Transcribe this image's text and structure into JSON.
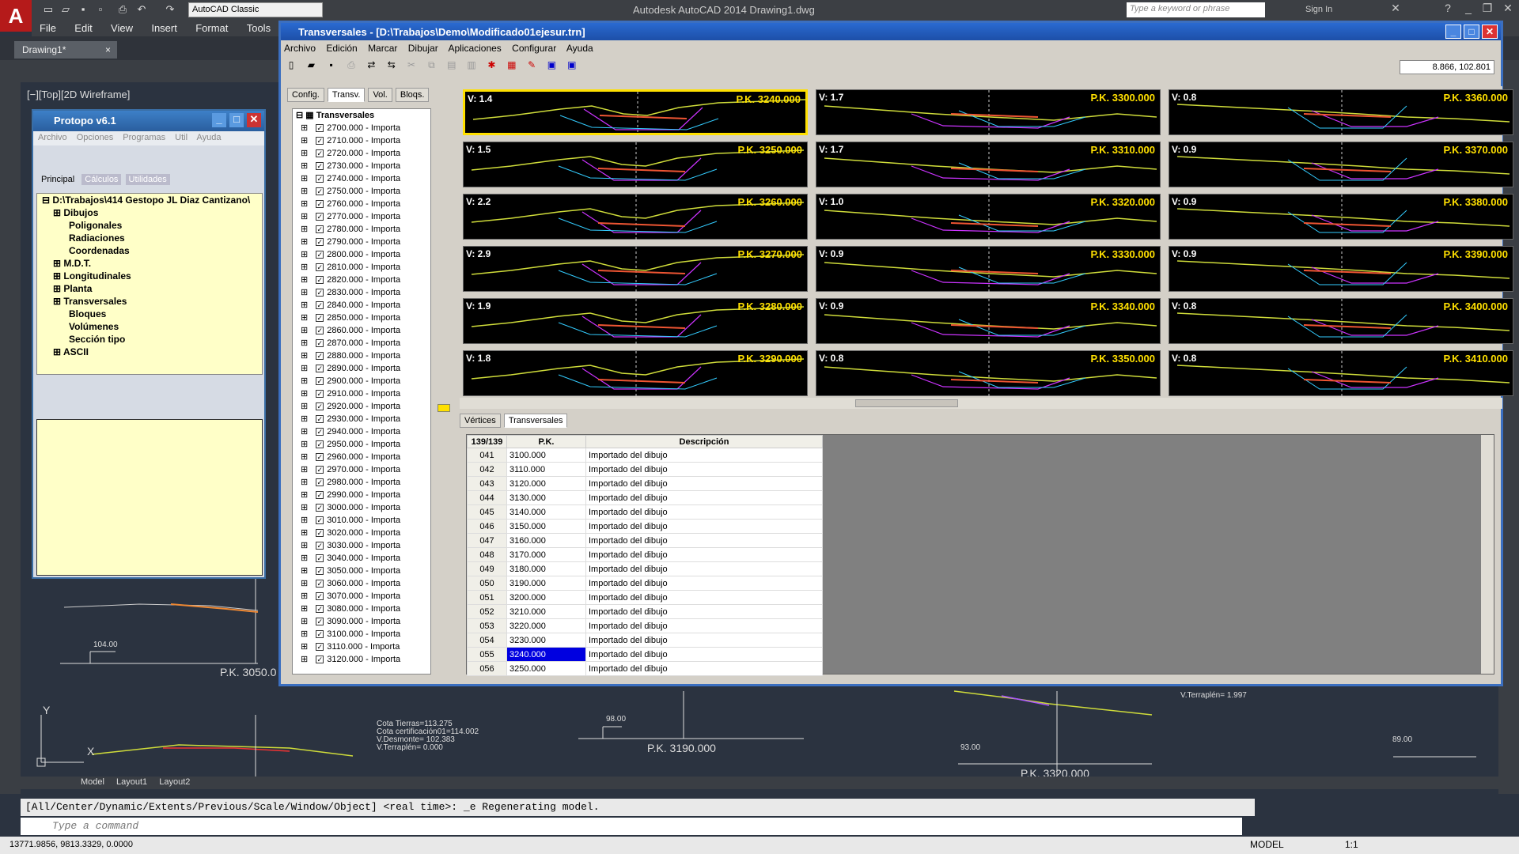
{
  "acad": {
    "logo": "A",
    "workspace": "AutoCAD Classic",
    "title": "Autodesk AutoCAD 2014    Drawing1.dwg",
    "search_placeholder": "Type a keyword or phrase",
    "signin": "Sign In",
    "menu": [
      "File",
      "Edit",
      "View",
      "Insert",
      "Format",
      "Tools"
    ],
    "doc_tab": "Drawing1*",
    "viewport_label": "[−][Top][2D Wireframe]",
    "layout_tabs": [
      "Model",
      "Layout1",
      "Layout2"
    ],
    "command_history": "[All/Center/Dynamic/Extents/Previous/Scale/Window/Object] <real time>: _e Regenerating model.",
    "command_placeholder": "Type a command",
    "coords": "13771.9856, 9813.3329, 0.0000",
    "model_label": "MODEL",
    "scale": "1:1"
  },
  "canvas": {
    "labels_top": [
      "104.00",
      "P.K. 3050.0"
    ],
    "info_block": [
      "Cota Tierras=113.275",
      "Cota certificación01=114.002",
      "V.Desmonte= 102.383",
      "V.Terraplén= 0.000"
    ],
    "label_9800": "98.00",
    "pk_3190": "P.K. 3190.000",
    "label_9300": "93.00",
    "pk_3320": "P.K. 3320.000",
    "label_8900": "89.00",
    "vterraplen": "V.Terraplén= 1.997",
    "axis_y": "Y",
    "axis_x": "X"
  },
  "protopo": {
    "title": "Protopo v6.1",
    "menu": [
      "Archivo",
      "Opciones",
      "Programas",
      "Util",
      "Ayuda"
    ],
    "tabs": [
      "Principal",
      "Cálculos",
      "Utilidades"
    ],
    "tree_root": "D:\\Trabajos\\414 Gestopo JL Diaz Cantizano\\",
    "tree_items": [
      "Dibujos",
      "Poligonales",
      "Radiaciones",
      "Coordenadas",
      "M.D.T.",
      "Longitudinales",
      "Planta",
      "Transversales",
      "Bloques",
      "Volúmenes",
      "Sección tipo",
      "ASCII"
    ]
  },
  "tw": {
    "title": "Transversales - [D:\\Trabajos\\Demo\\Modificado01ejesur.trn]",
    "menu": [
      "Archivo",
      "Edición",
      "Marcar",
      "Dibujar",
      "Aplicaciones",
      "Configurar",
      "Ayuda"
    ],
    "coord_readout": "8.866, 102.801",
    "left_tabs": [
      "Config.",
      "Transv.",
      "Vol.",
      "Bloqs."
    ],
    "tree_root": "Transversales",
    "tree_items": [
      "2700.000 - Importa",
      "2710.000 - Importa",
      "2720.000 - Importa",
      "2730.000 - Importa",
      "2740.000 - Importa",
      "2750.000 - Importa",
      "2760.000 - Importa",
      "2770.000 - Importa",
      "2780.000 - Importa",
      "2790.000 - Importa",
      "2800.000 - Importa",
      "2810.000 - Importa",
      "2820.000 - Importa",
      "2830.000 - Importa",
      "2840.000 - Importa",
      "2850.000 - Importa",
      "2860.000 - Importa",
      "2870.000 - Importa",
      "2880.000 - Importa",
      "2890.000 - Importa",
      "2900.000 - Importa",
      "2910.000 - Importa",
      "2920.000 - Importa",
      "2930.000 - Importa",
      "2940.000 - Importa",
      "2950.000 - Importa",
      "2960.000 - Importa",
      "2970.000 - Importa",
      "2980.000 - Importa",
      "2990.000 - Importa",
      "3000.000 - Importa",
      "3010.000 - Importa",
      "3020.000 - Importa",
      "3030.000 - Importa",
      "3040.000 - Importa",
      "3050.000 - Importa",
      "3060.000 - Importa",
      "3070.000 - Importa",
      "3080.000 - Importa",
      "3090.000 - Importa",
      "3100.000 - Importa",
      "3110.000 - Importa",
      "3120.000 - Importa"
    ],
    "sections": [
      {
        "v": "V: 1.4",
        "pk": "P.K. 3240.000"
      },
      {
        "v": "V: 1.7",
        "pk": "P.K. 3300.000"
      },
      {
        "v": "V: 0.8",
        "pk": "P.K. 3360.000"
      },
      {
        "v": "V: 1.5",
        "pk": "P.K. 3250.000"
      },
      {
        "v": "V: 1.7",
        "pk": "P.K. 3310.000"
      },
      {
        "v": "V: 0.9",
        "pk": "P.K. 3370.000"
      },
      {
        "v": "V: 2.2",
        "pk": "P.K. 3260.000"
      },
      {
        "v": "V: 1.0",
        "pk": "P.K. 3320.000"
      },
      {
        "v": "V: 0.9",
        "pk": "P.K. 3380.000"
      },
      {
        "v": "V: 2.9",
        "pk": "P.K. 3270.000"
      },
      {
        "v": "V: 0.9",
        "pk": "P.K. 3330.000"
      },
      {
        "v": "V: 0.9",
        "pk": "P.K. 3390.000"
      },
      {
        "v": "V: 1.9",
        "pk": "P.K. 3280.000"
      },
      {
        "v": "V: 0.9",
        "pk": "P.K. 3340.000"
      },
      {
        "v": "V: 0.8",
        "pk": "P.K. 3400.000"
      },
      {
        "v": "V: 1.8",
        "pk": "P.K. 3290.000"
      },
      {
        "v": "V: 0.8",
        "pk": "P.K. 3350.000"
      },
      {
        "v": "V: 0.8",
        "pk": "P.K. 3410.000"
      }
    ],
    "bottom_tabs": [
      "Vértices",
      "Transversales"
    ],
    "grid_headers": [
      "139/139",
      "P.K.",
      "Descripción"
    ],
    "grid_rows": [
      [
        "041",
        "3100.000",
        "Importado del dibujo"
      ],
      [
        "042",
        "3110.000",
        "Importado del dibujo"
      ],
      [
        "043",
        "3120.000",
        "Importado del dibujo"
      ],
      [
        "044",
        "3130.000",
        "Importado del dibujo"
      ],
      [
        "045",
        "3140.000",
        "Importado del dibujo"
      ],
      [
        "046",
        "3150.000",
        "Importado del dibujo"
      ],
      [
        "047",
        "3160.000",
        "Importado del dibujo"
      ],
      [
        "048",
        "3170.000",
        "Importado del dibujo"
      ],
      [
        "049",
        "3180.000",
        "Importado del dibujo"
      ],
      [
        "050",
        "3190.000",
        "Importado del dibujo"
      ],
      [
        "051",
        "3200.000",
        "Importado del dibujo"
      ],
      [
        "052",
        "3210.000",
        "Importado del dibujo"
      ],
      [
        "053",
        "3220.000",
        "Importado del dibujo"
      ],
      [
        "054",
        "3230.000",
        "Importado del dibujo"
      ],
      [
        "055",
        "3240.000",
        "Importado del dibujo"
      ],
      [
        "056",
        "3250.000",
        "Importado del dibujo"
      ]
    ],
    "selected_row": "055"
  }
}
